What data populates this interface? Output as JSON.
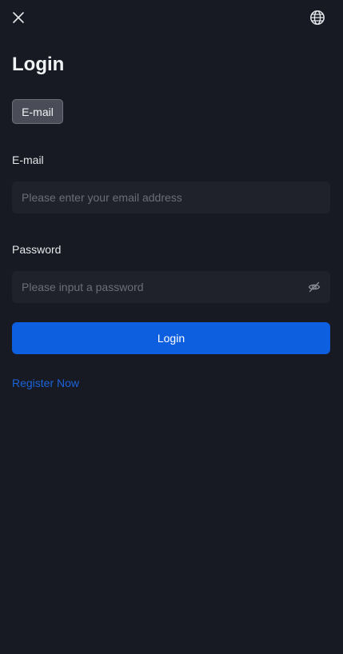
{
  "header": {
    "close_icon": "close-icon",
    "language_icon": "globe-icon"
  },
  "page": {
    "title": "Login"
  },
  "tabs": [
    {
      "label": "E-mail",
      "active": true
    }
  ],
  "form": {
    "email": {
      "label": "E-mail",
      "placeholder": "Please enter your email address",
      "value": ""
    },
    "password": {
      "label": "Password",
      "placeholder": "Please input a password",
      "value": "",
      "visibility_icon": "eye-off-icon"
    },
    "submit_label": "Login"
  },
  "footer": {
    "register_label": "Register Now"
  },
  "colors": {
    "background": "#181a23",
    "input_background": "#1f222b",
    "primary": "#0d5fe0",
    "link": "#1b63d9",
    "tab_active": "#4a4d57"
  }
}
